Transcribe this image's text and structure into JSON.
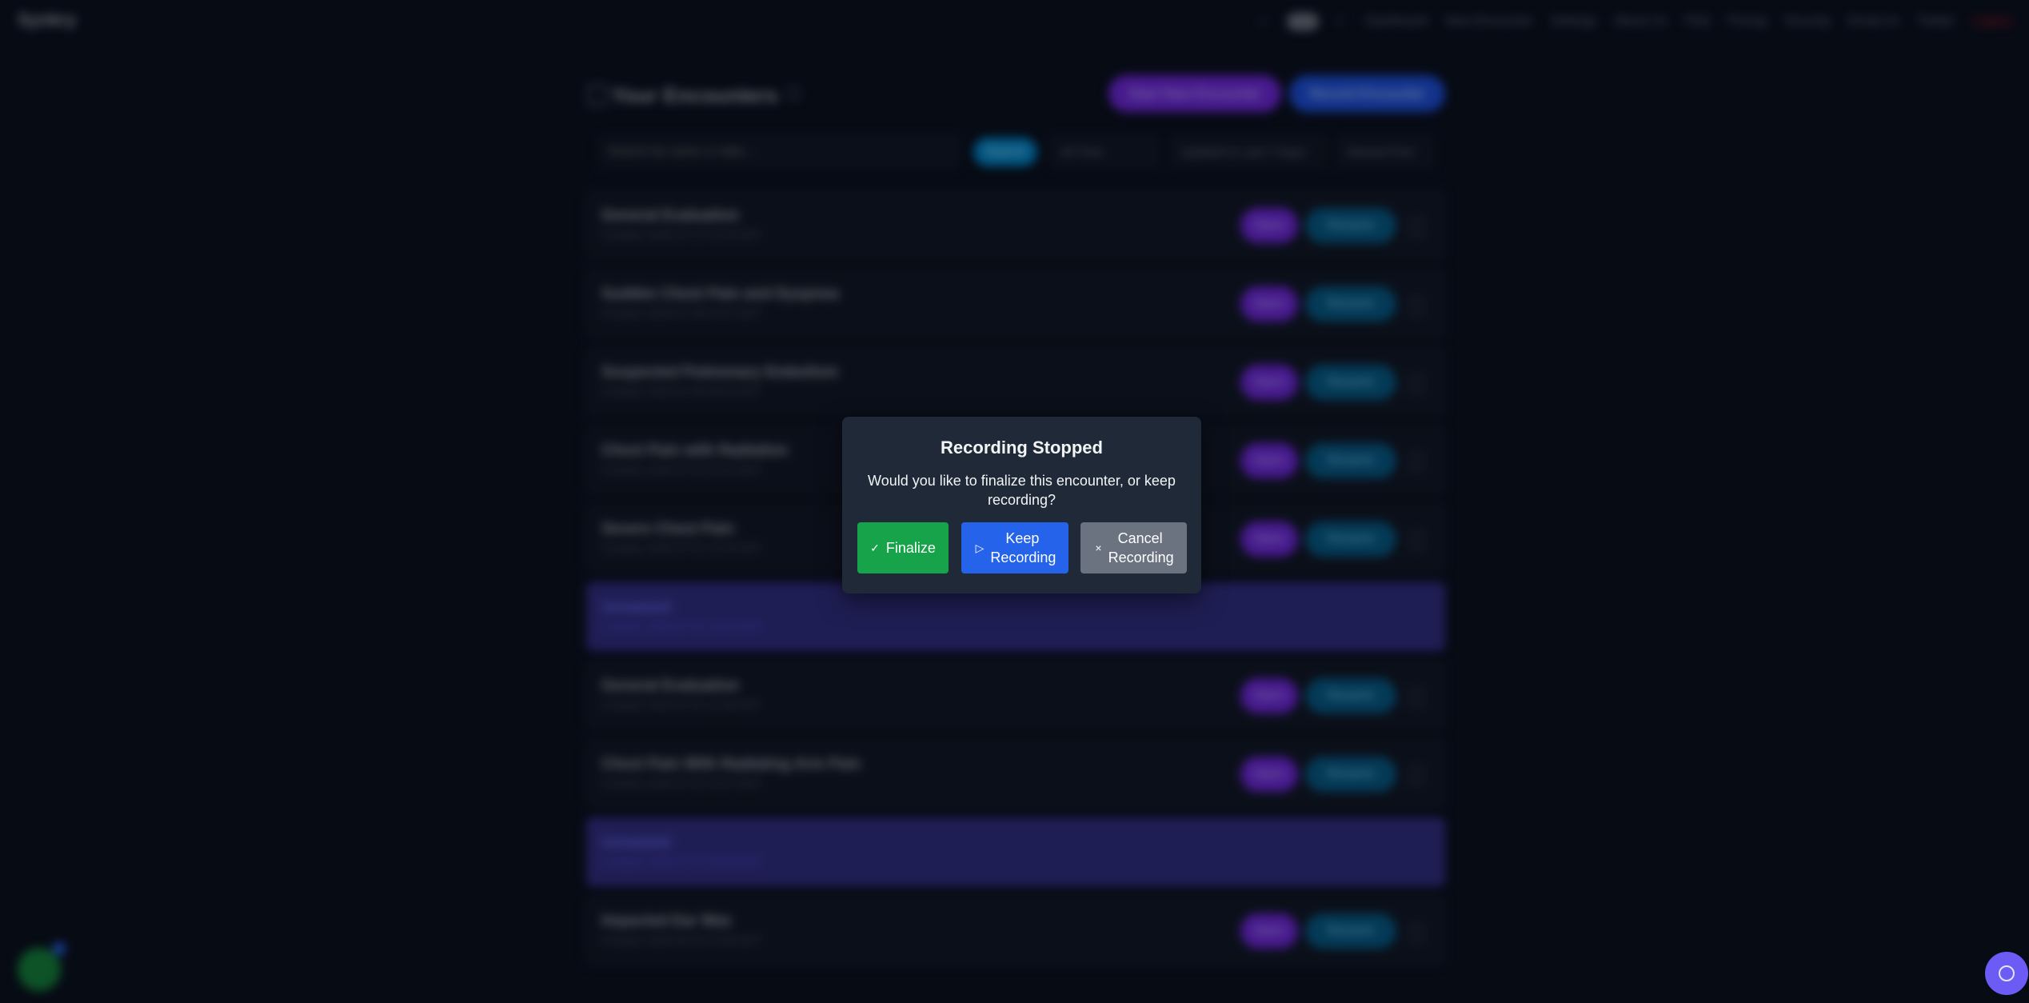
{
  "topbar": {
    "brand": "Synkry",
    "nav": [
      "Dashboard",
      "New Encounter",
      "Settings",
      "About Us",
      "FAQ",
      "Pricing",
      "Security",
      "Email Us",
      "Twitter",
      "Logout"
    ]
  },
  "page": {
    "title": "Your Encounters",
    "start_new_label": "Start New Encounter",
    "record_label": "Record Encounter",
    "search_placeholder": "Search by name or date...",
    "search_button": "Search",
    "filter_time": "All Time",
    "filter_updated": "Updated in Last 7 Days",
    "sort": "Newest First"
  },
  "encounters": [
    {
      "title": "General Evaluation",
      "created": "Created: 2025-07-17 14:34 EDT"
    },
    {
      "title": "Sudden Chest Pain and Dyspnea",
      "created": "Created: 2025-07-08 10:07 EDT"
    },
    {
      "title": "Suspected Pulmonary Embolism",
      "created": "Created: 2025-07-08 09:51 EDT"
    },
    {
      "title": "Chest Pain with Radiation",
      "created": "Created: 2025-07-02 15:01 EDT"
    },
    {
      "title": "Severe Chest Pain",
      "created": "Created: 2025-07-02 14:44 EDT"
    },
    {
      "title": "Unnamed",
      "created": "Created: 2025-07-01 10:22 EDT"
    },
    {
      "title": "General Evaluation",
      "created": "Created: 2025-07-01 12:38 EDT"
    },
    {
      "title": "Chest Pain With Radiating Arm Pain",
      "created": "Created: 2025-07-01 10:47 EDT"
    },
    {
      "title": "Unnamed",
      "created": "Created: 2025-07-01 09:49 EDT"
    },
    {
      "title": "Impacted Ear Wax",
      "created": "Created: 2025-06-30 15:59 EDT"
    }
  ],
  "row_actions": {
    "open": "Open",
    "rename": "Rename"
  },
  "modal": {
    "title": "Recording Stopped",
    "message": "Would you like to finalize this encounter, or keep recording?",
    "finalize": "Finalize",
    "keep": "Keep Recording",
    "cancel": "Cancel Recording",
    "finalize_icon": "check-icon",
    "keep_icon": "play-icon",
    "cancel_icon": "close-icon"
  },
  "colors": {
    "finalize": "#16a34a",
    "keep": "#2563eb",
    "cancel": "#6b7280",
    "modal_bg": "#1f2937"
  }
}
